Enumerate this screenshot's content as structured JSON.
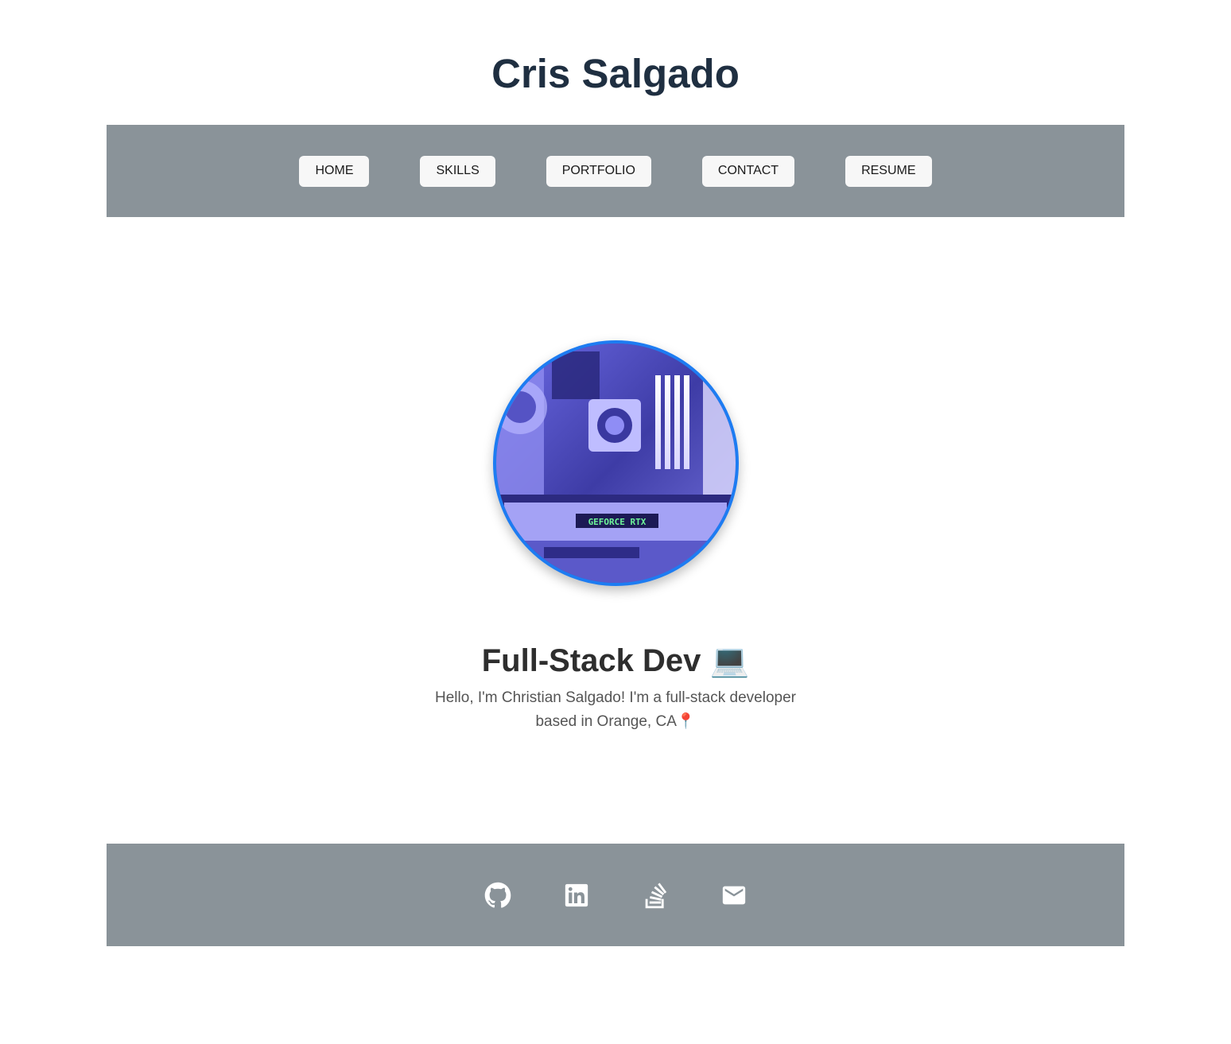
{
  "header": {
    "title": "Cris Salgado"
  },
  "nav": {
    "items": [
      {
        "label": "HOME"
      },
      {
        "label": "SKILLS"
      },
      {
        "label": "PORTFOLIO"
      },
      {
        "label": "CONTACT"
      },
      {
        "label": "RESUME"
      }
    ]
  },
  "hero": {
    "image_alt": "PC build with GeForce RTX graphics card",
    "image_text": "GEFORCE RTX",
    "heading": "Full-Stack Dev 💻",
    "description": "Hello, I'm Christian Salgado! I'm a full-stack developer based in Orange, CA📍"
  },
  "footer": {
    "links": [
      {
        "icon": "github-icon"
      },
      {
        "icon": "linkedin-icon"
      },
      {
        "icon": "stackoverflow-icon"
      },
      {
        "icon": "email-icon"
      }
    ]
  },
  "colors": {
    "title": "#1f2f41",
    "bar_background": "#8a9399",
    "avatar_border": "#1d7cf2",
    "nav_button_background": "#f7f7f7"
  }
}
